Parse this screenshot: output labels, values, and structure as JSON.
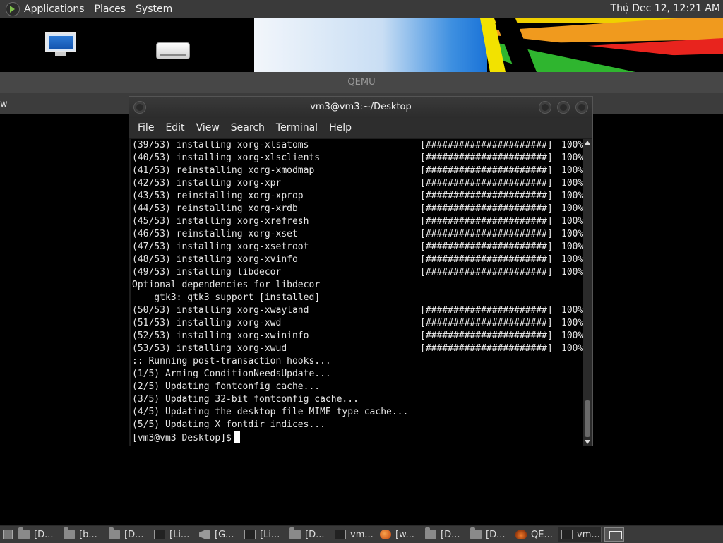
{
  "top_panel": {
    "menus": [
      "Applications",
      "Places",
      "System"
    ],
    "clock": "Thu Dec 12, 12:21 AM"
  },
  "qemu": {
    "title": "QEMU",
    "menu_fragment": "w"
  },
  "terminal": {
    "title": "vm3@vm3:~/Desktop",
    "menu": [
      "File",
      "Edit",
      "View",
      "Search",
      "Terminal",
      "Help"
    ],
    "lines": [
      {
        "text": "(39/53) installing xorg-xlsatoms",
        "bar": "[######################]",
        "pct": "100%"
      },
      {
        "text": "(40/53) installing xorg-xlsclients",
        "bar": "[######################]",
        "pct": "100%"
      },
      {
        "text": "(41/53) reinstalling xorg-xmodmap",
        "bar": "[######################]",
        "pct": "100%"
      },
      {
        "text": "(42/53) installing xorg-xpr",
        "bar": "[######################]",
        "pct": "100%"
      },
      {
        "text": "(43/53) reinstalling xorg-xprop",
        "bar": "[######################]",
        "pct": "100%"
      },
      {
        "text": "(44/53) reinstalling xorg-xrdb",
        "bar": "[######################]",
        "pct": "100%"
      },
      {
        "text": "(45/53) installing xorg-xrefresh",
        "bar": "[######################]",
        "pct": "100%"
      },
      {
        "text": "(46/53) reinstalling xorg-xset",
        "bar": "[######################]",
        "pct": "100%"
      },
      {
        "text": "(47/53) installing xorg-xsetroot",
        "bar": "[######################]",
        "pct": "100%"
      },
      {
        "text": "(48/53) installing xorg-xvinfo",
        "bar": "[######################]",
        "pct": "100%"
      },
      {
        "text": "(49/53) installing libdecor",
        "bar": "[######################]",
        "pct": "100%"
      },
      {
        "text": "Optional dependencies for libdecor",
        "bar": "",
        "pct": ""
      },
      {
        "text": "    gtk3: gtk3 support [installed]",
        "bar": "",
        "pct": ""
      },
      {
        "text": "(50/53) installing xorg-xwayland",
        "bar": "[######################]",
        "pct": "100%"
      },
      {
        "text": "(51/53) installing xorg-xwd",
        "bar": "[######################]",
        "pct": "100%"
      },
      {
        "text": "(52/53) installing xorg-xwininfo",
        "bar": "[######################]",
        "pct": "100%"
      },
      {
        "text": "(53/53) installing xorg-xwud",
        "bar": "[######################]",
        "pct": "100%"
      },
      {
        "text": ":: Running post-transaction hooks...",
        "bar": "",
        "pct": ""
      },
      {
        "text": "(1/5) Arming ConditionNeedsUpdate...",
        "bar": "",
        "pct": ""
      },
      {
        "text": "(2/5) Updating fontconfig cache...",
        "bar": "",
        "pct": ""
      },
      {
        "text": "(3/5) Updating 32-bit fontconfig cache...",
        "bar": "",
        "pct": ""
      },
      {
        "text": "(4/5) Updating the desktop file MIME type cache...",
        "bar": "",
        "pct": ""
      },
      {
        "text": "(5/5) Updating X fontdir indices...",
        "bar": "",
        "pct": ""
      }
    ],
    "prompt": "[vm3@vm3 Desktop]$"
  },
  "taskbar": {
    "items": [
      {
        "icon": "folder-icon",
        "label": "[D..."
      },
      {
        "icon": "folder-icon",
        "label": "[b..."
      },
      {
        "icon": "folder-icon",
        "label": "[D..."
      },
      {
        "icon": "terminal-icon",
        "label": "[Li..."
      },
      {
        "icon": "vscode-icon",
        "label": "[G..."
      },
      {
        "icon": "terminal-icon",
        "label": "[Li..."
      },
      {
        "icon": "folder-icon",
        "label": "[D..."
      },
      {
        "icon": "terminal-icon",
        "label": "vm..."
      },
      {
        "icon": "firefox-icon",
        "label": "[w..."
      },
      {
        "icon": "folder-icon",
        "label": "[D..."
      },
      {
        "icon": "folder-icon",
        "label": "[D..."
      },
      {
        "icon": "qemu-icon",
        "label": "QE..."
      },
      {
        "icon": "terminal-icon",
        "label": "vm...",
        "active": true
      }
    ]
  }
}
